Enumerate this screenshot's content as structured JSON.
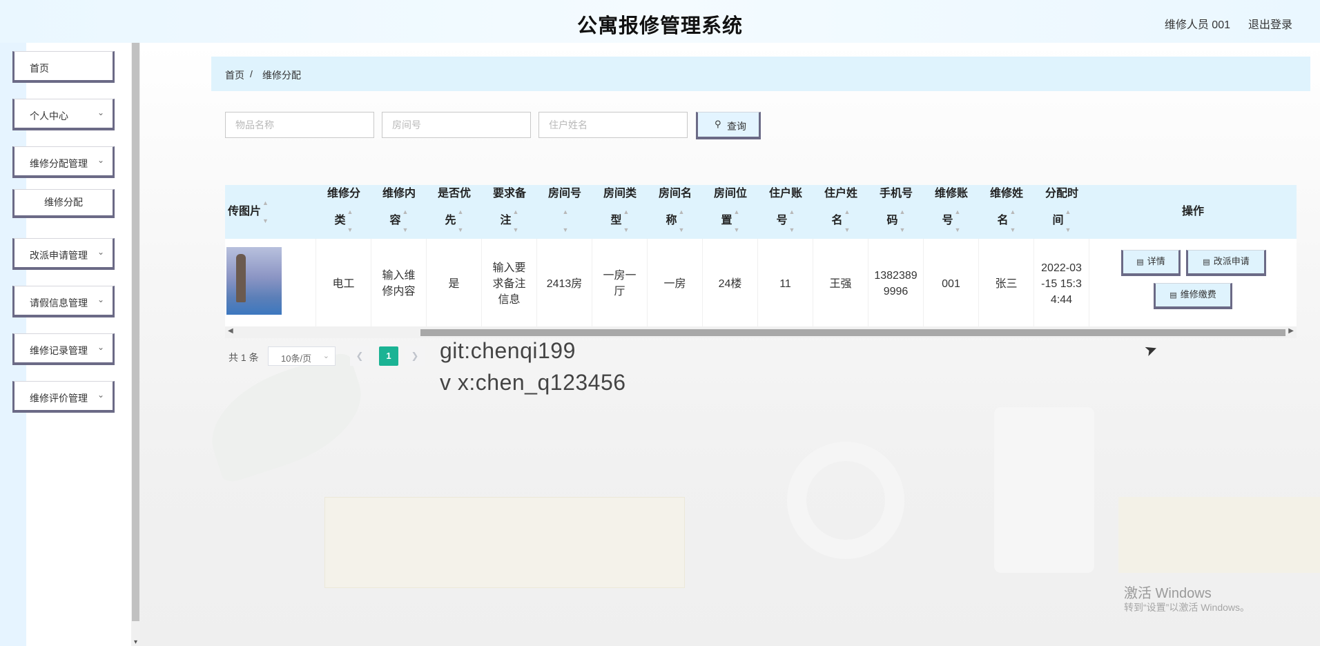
{
  "header": {
    "title": "公寓报修管理系统",
    "user": "维修人员 001",
    "logout": "退出登录"
  },
  "sidebar": {
    "items": [
      {
        "label": "首页"
      },
      {
        "label": "个人中心"
      },
      {
        "label": "维修分配管理"
      },
      {
        "label": "维修分配"
      },
      {
        "label": "改派申请管理"
      },
      {
        "label": "请假信息管理"
      },
      {
        "label": "维修记录管理"
      },
      {
        "label": "维修评价管理"
      }
    ]
  },
  "breadcrumb": {
    "home": "首页",
    "sep": "/",
    "current": "维修分配"
  },
  "search": {
    "item_placeholder": "物品名称",
    "room_placeholder": "房间号",
    "resident_placeholder": "住户姓名",
    "button": "查询"
  },
  "table": {
    "headers": [
      {
        "line1": "传图片",
        "line2": ""
      },
      {
        "line1": "维修分",
        "line2": "类"
      },
      {
        "line1": "维修内",
        "line2": "容"
      },
      {
        "line1": "是否优",
        "line2": "先"
      },
      {
        "line1": "要求备",
        "line2": "注"
      },
      {
        "line1": "房间号",
        "line2": ""
      },
      {
        "line1": "房间类",
        "line2": "型"
      },
      {
        "line1": "房间名",
        "line2": "称"
      },
      {
        "line1": "房间位",
        "line2": "置"
      },
      {
        "line1": "住户账",
        "line2": "号"
      },
      {
        "line1": "住户姓",
        "line2": "名"
      },
      {
        "line1": "手机号",
        "line2": "码"
      },
      {
        "line1": "维修账",
        "line2": "号"
      },
      {
        "line1": "维修姓",
        "line2": "名"
      },
      {
        "line1": "分配时",
        "line2": "间"
      }
    ],
    "op_header": "操作",
    "row": {
      "category": "电工",
      "content": "输入维修内容",
      "priority": "是",
      "remark": "输入要求备注信息",
      "room_no": "2413房",
      "room_type": "一房一厅",
      "room_name": "一房",
      "room_location": "24楼",
      "resident_account": "11",
      "resident_name": "王强",
      "phone": "13823899996",
      "repair_account": "001",
      "repair_name": "张三",
      "assign_time": "2022-03-15 15:34:44"
    },
    "actions": {
      "detail": "详情",
      "reassign": "改派申请",
      "payment": "维修缴费"
    }
  },
  "pagination": {
    "total": "共 1 条",
    "page_size": "10条/页",
    "current_page": "1"
  },
  "watermark": {
    "line1": "git:chenqi199",
    "line2": "v x:chen_q123456"
  },
  "windows": {
    "activate": "激活 Windows",
    "hint": "转到“设置”以激活 Windows。"
  },
  "colors": {
    "accent_green": "#1bb394",
    "header_bg": "#dff3fd",
    "button_border": "#6b6a86"
  }
}
